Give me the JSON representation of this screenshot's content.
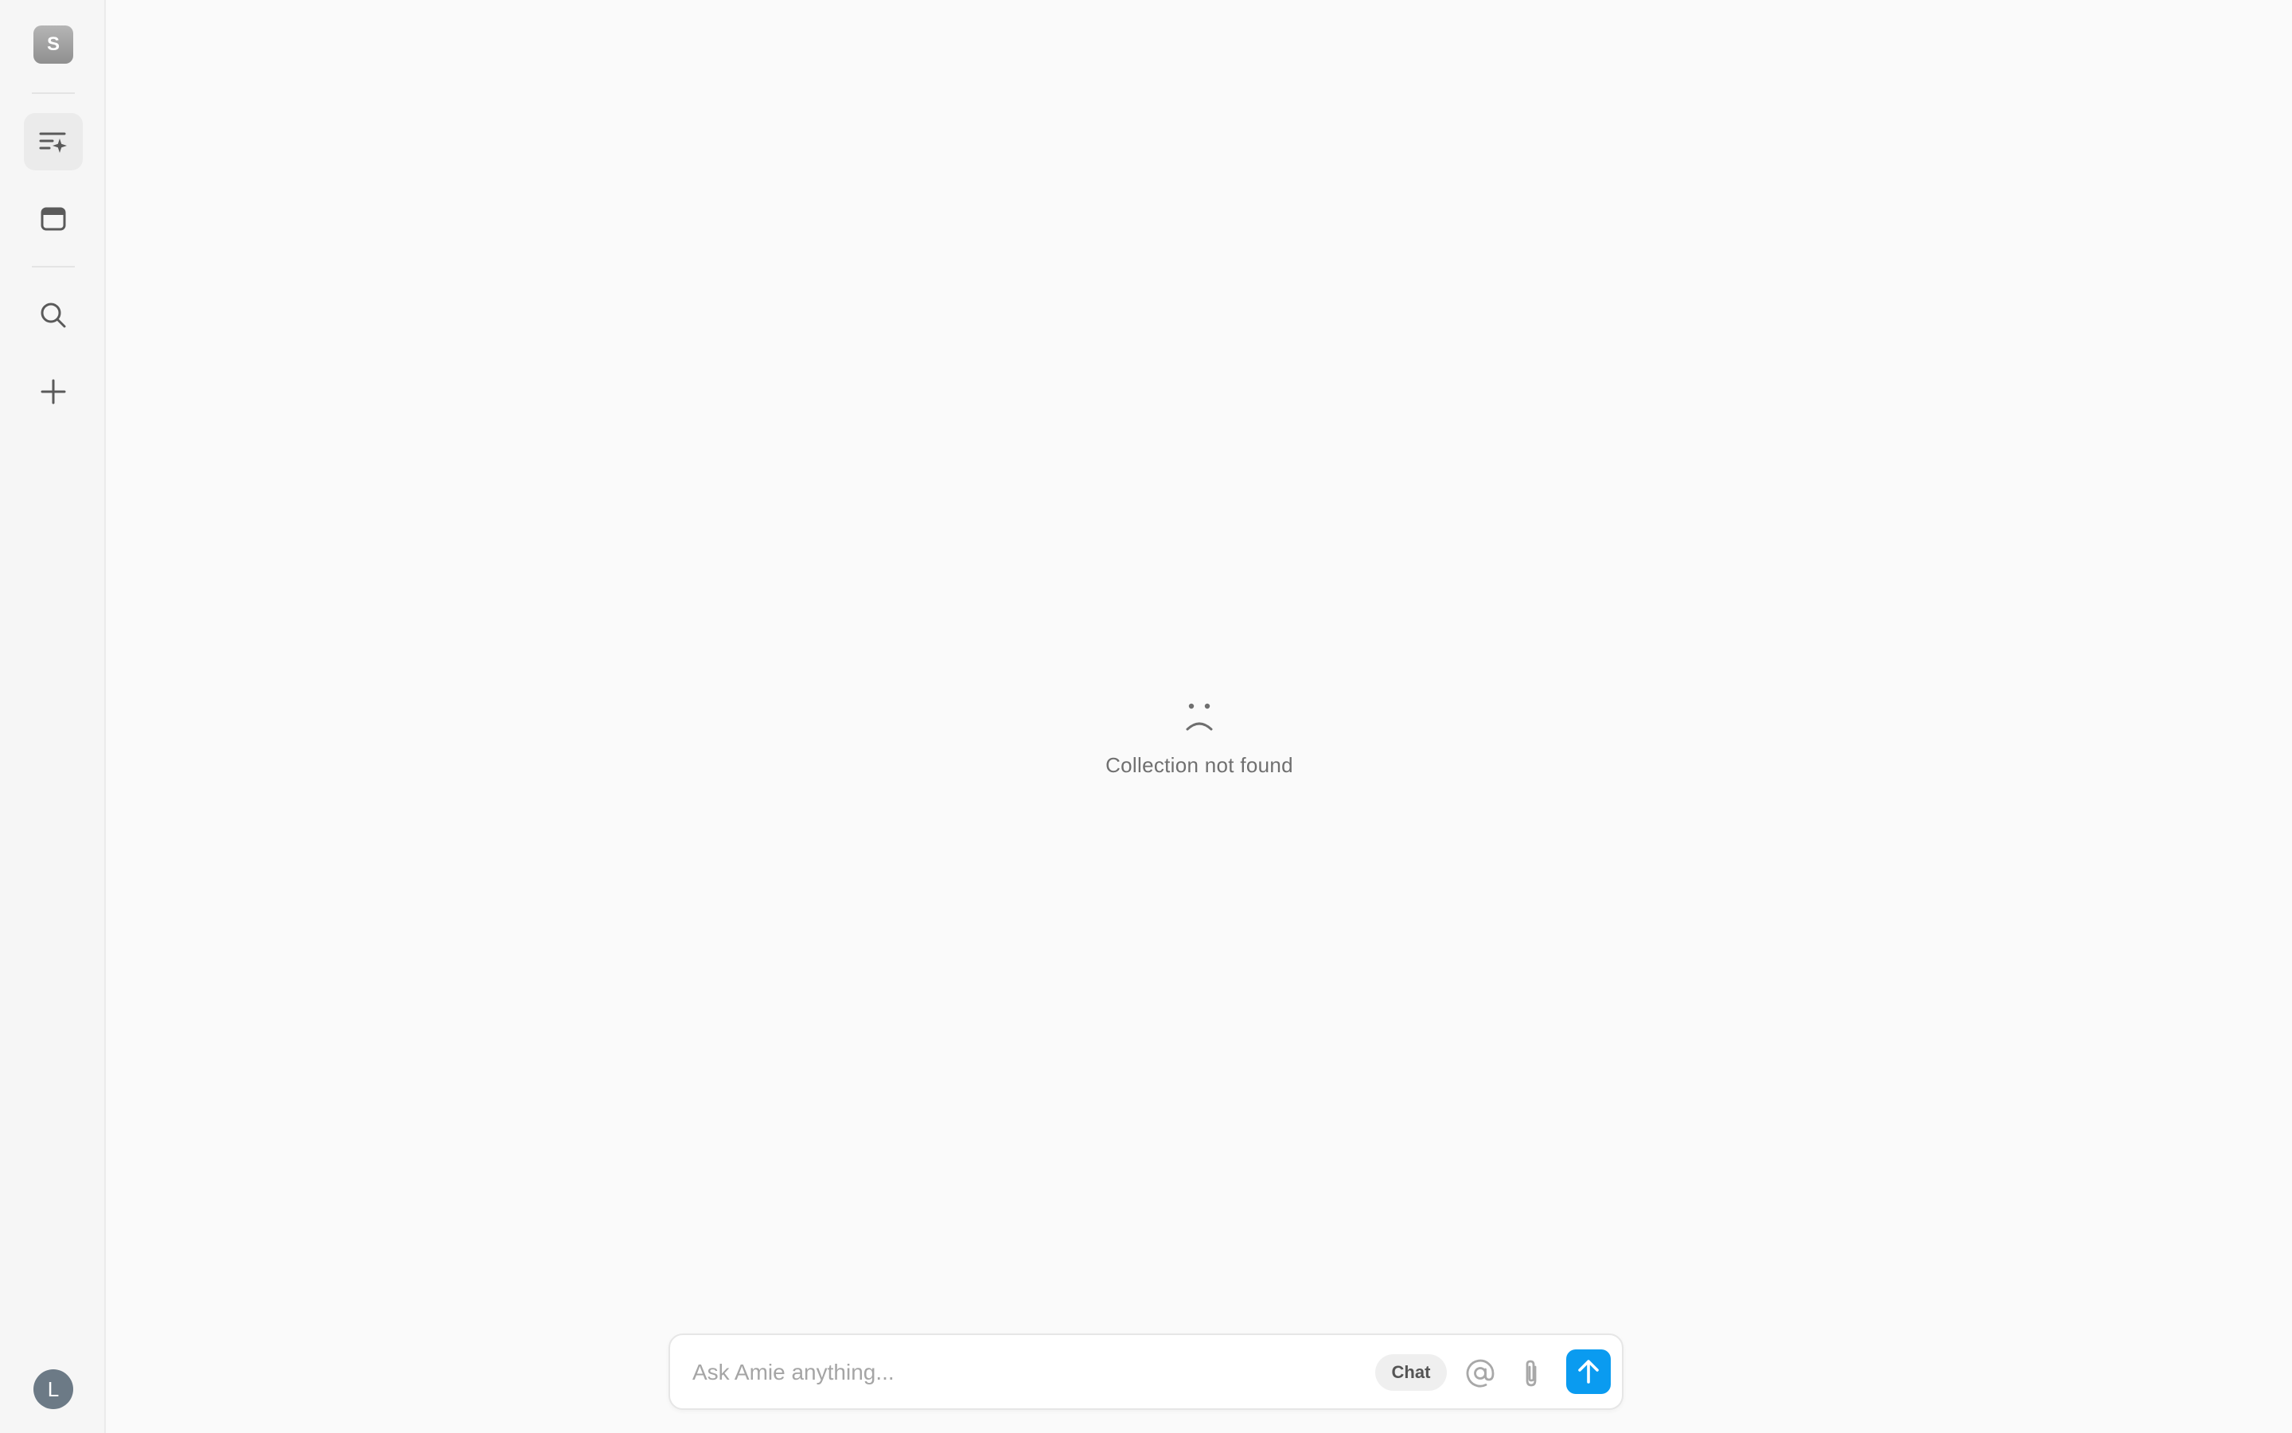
{
  "sidebar": {
    "workspace_initial": "S",
    "user_initial": "L",
    "items": [
      {
        "icon": "ai-list-icon",
        "active": true
      },
      {
        "icon": "calendar-icon",
        "active": false
      },
      {
        "icon": "search-icon",
        "active": false
      },
      {
        "icon": "plus-icon",
        "active": false
      }
    ]
  },
  "main": {
    "empty_icon": "sad-face-icon",
    "empty_message": "Collection not found"
  },
  "chat": {
    "placeholder": "Ask Amie anything...",
    "mode_label": "Chat",
    "icons": [
      "at-icon",
      "paperclip-icon",
      "send-arrow-icon"
    ]
  },
  "colors": {
    "accent": "#0a9bf0",
    "background": "#fafafa",
    "sidebar": "#f6f6f6",
    "avatar": "#6c7a86"
  }
}
